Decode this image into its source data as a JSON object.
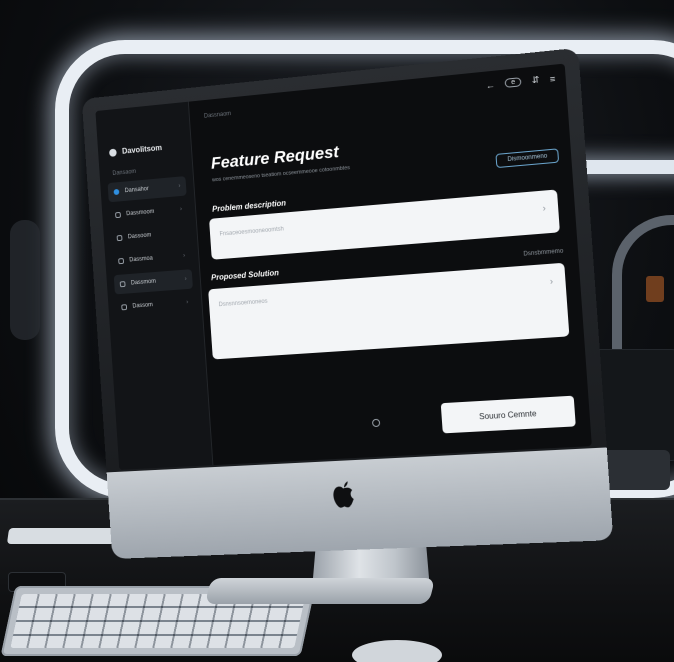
{
  "app": {
    "brand": "Davolitsom",
    "section": "Dansaom",
    "breadcrumb": "Dassnaom"
  },
  "sidebar": {
    "items": [
      {
        "label": "Dansahor",
        "active": true
      },
      {
        "label": "Dassmoom",
        "active": false
      },
      {
        "label": "Dassoom",
        "active": false
      },
      {
        "label": "Dassmoa",
        "active": false
      },
      {
        "label": "Dassmom",
        "active": false
      },
      {
        "label": "Dassom",
        "active": false
      }
    ]
  },
  "topbar": {
    "back_glyph": "←",
    "pill_text": "e",
    "action_glyph": "⇵",
    "menu_glyph": "≡"
  },
  "form": {
    "title": "Feature Request",
    "subtitle": "wos cenemmeoseno tseatiom ocseemmeooe cotoonmbtes",
    "primary_button": "Dismoonmeno",
    "problem_label": "Problem description",
    "problem_placeholder": "Fnsaceoesmooneoomtsh",
    "solution_label": "Proposed Solution",
    "solution_hint": "Dsnsbmmemo",
    "solution_placeholder": "Dsnsnnsoemoneos",
    "submit_label": "Souuro Cemnte"
  },
  "icons": {
    "chevron": "chevron-right-icon",
    "apple": "apple-logo-icon"
  }
}
